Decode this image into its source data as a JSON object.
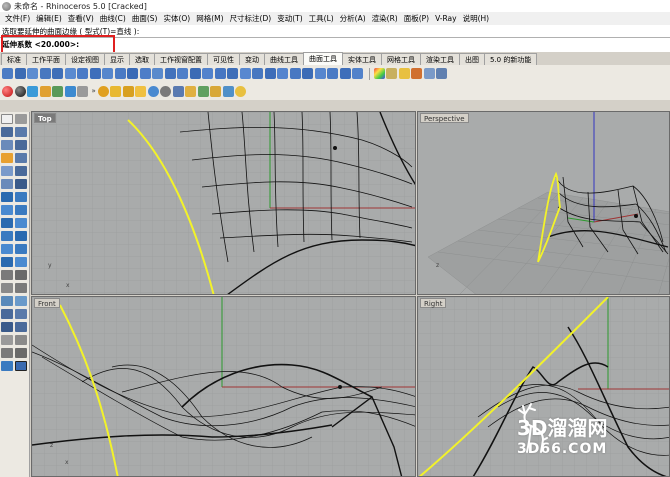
{
  "window": {
    "title": "未命名 - Rhinoceros 5.0 [Cracked]"
  },
  "menubar": {
    "items": [
      "文件(F)",
      "编辑(E)",
      "查看(V)",
      "曲线(C)",
      "曲面(S)",
      "实体(O)",
      "网格(M)",
      "尺寸标注(D)",
      "变动(T)",
      "工具(L)",
      "分析(A)",
      "渲染(R)",
      "面板(P)",
      "V-Ray",
      "说明(H)"
    ]
  },
  "command": {
    "history": "选取要延伸的曲面边缘 ( 型式(T)=直线 ):",
    "prompt": "延伸系数 <20.000>:",
    "highlight_color": "#e02020"
  },
  "tabs": {
    "items": [
      "标准",
      "工作平面",
      "设定视图",
      "显示",
      "选取",
      "工作视窗配置",
      "可见性",
      "变动",
      "曲线工具",
      "曲面工具",
      "实体工具",
      "网格工具",
      "渲染工具",
      "出图",
      "5.0 的新功能"
    ],
    "active": "曲面工具"
  },
  "viewports": {
    "top": {
      "label": "Top",
      "active": true
    },
    "perspective": {
      "label": "Perspective",
      "active": false
    },
    "front": {
      "label": "Front",
      "active": false
    },
    "right": {
      "label": "Right",
      "active": false
    }
  },
  "axes": {
    "x": "x",
    "y": "y",
    "z": "z"
  },
  "colors": {
    "viewport_bg": "#a9abab",
    "grid": "#979999",
    "selected_curve": "#f2f22a",
    "x_axis": "#a03434",
    "y_axis": "#2c9a2c",
    "z_axis": "#3434c0"
  },
  "watermark": {
    "brand": "3D溜溜网",
    "domain": "3D66.COM"
  },
  "icons": {
    "toolbar_row1": [
      "surface-from-points-icon",
      "surface-edge-icon",
      "planar-surface-icon",
      "extrude-icon",
      "loft-icon",
      "revolve-icon",
      "rail-revolve-icon",
      "sweep1-icon",
      "sweep2-icon",
      "network-icon",
      "patch-icon",
      "color-palette-icon",
      "layer-icon",
      "render-icon",
      "light-icon",
      "save-view-icon",
      "grid-icon"
    ],
    "toolbar_row2": [
      "shaded-sphere-icon",
      "rendered-sphere-icon",
      "material-icon",
      "cube-icon",
      "box-icon",
      "globe-icon",
      "dimension-icon",
      "gumball-icon",
      "osnap-icon",
      "split-icon",
      "trim-icon",
      "join-icon",
      "extend-surface-icon",
      "fillet-icon",
      "offset-icon",
      "blend-icon",
      "match-icon",
      "rebuild-icon",
      "analyze-icon",
      "zebra-icon"
    ]
  }
}
